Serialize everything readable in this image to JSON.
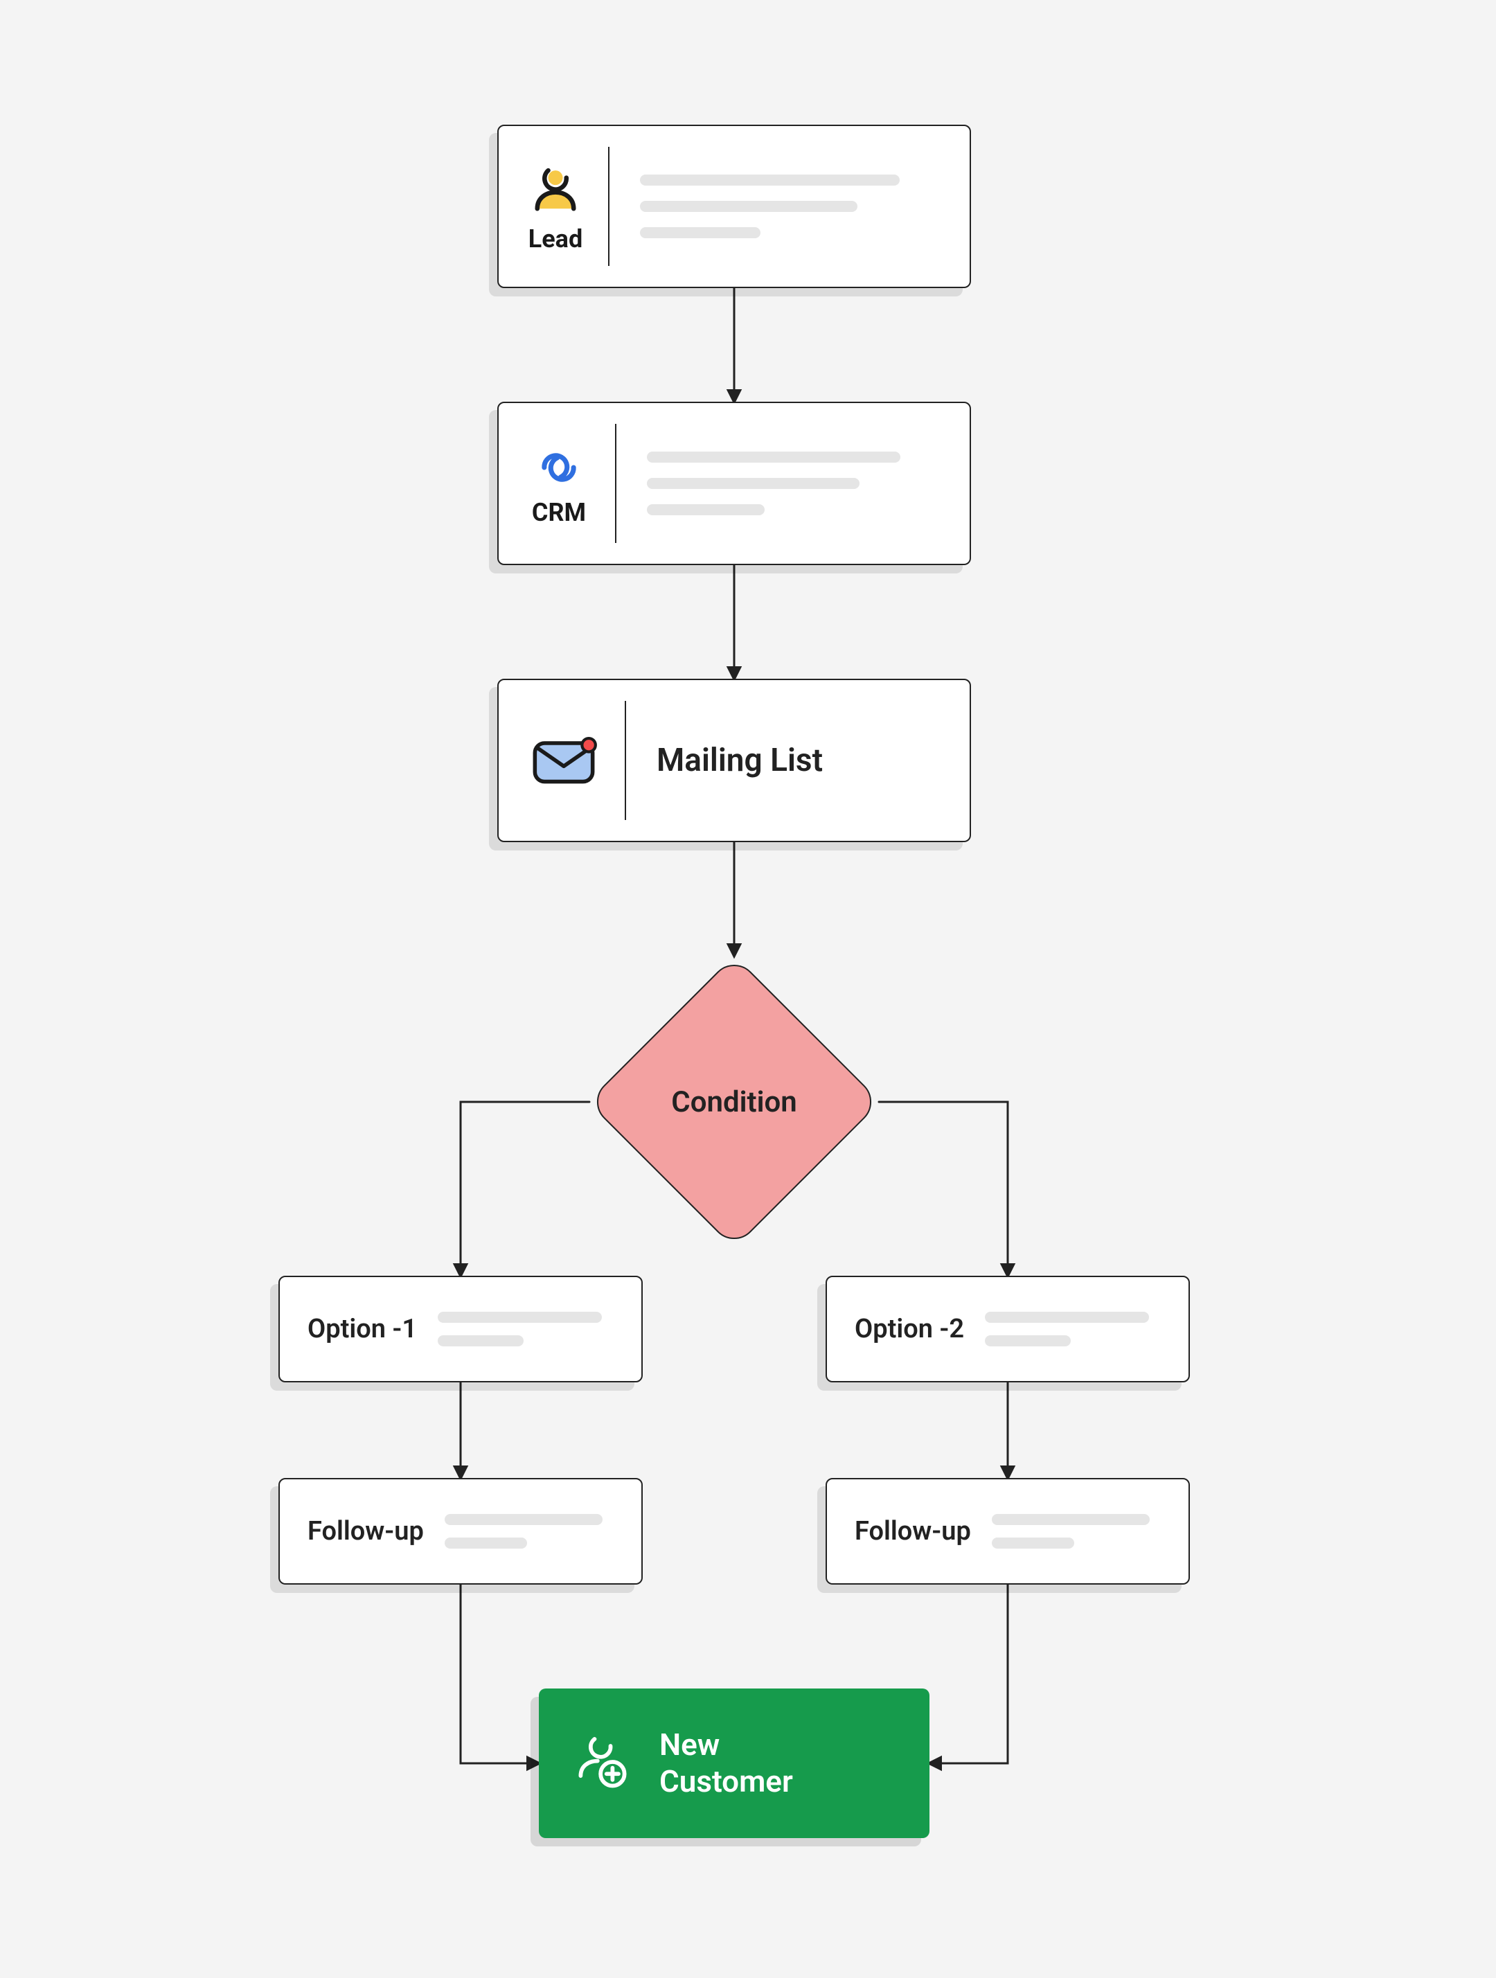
{
  "nodes": {
    "lead": {
      "label": "Lead"
    },
    "crm": {
      "label": "CRM"
    },
    "mailing": {
      "title": "Mailing List"
    },
    "condition": {
      "label": "Condition"
    },
    "option1": {
      "label": "Option -1"
    },
    "option2": {
      "label": "Option -2"
    },
    "followup1": {
      "label": "Follow-up"
    },
    "followup2": {
      "label": "Follow-up"
    },
    "new_customer": {
      "line1": "New",
      "line2": "Customer"
    }
  },
  "colors": {
    "condition_fill": "#f3a1a1",
    "end_fill": "#169b4c",
    "placeholder": "#e5e5e5"
  }
}
